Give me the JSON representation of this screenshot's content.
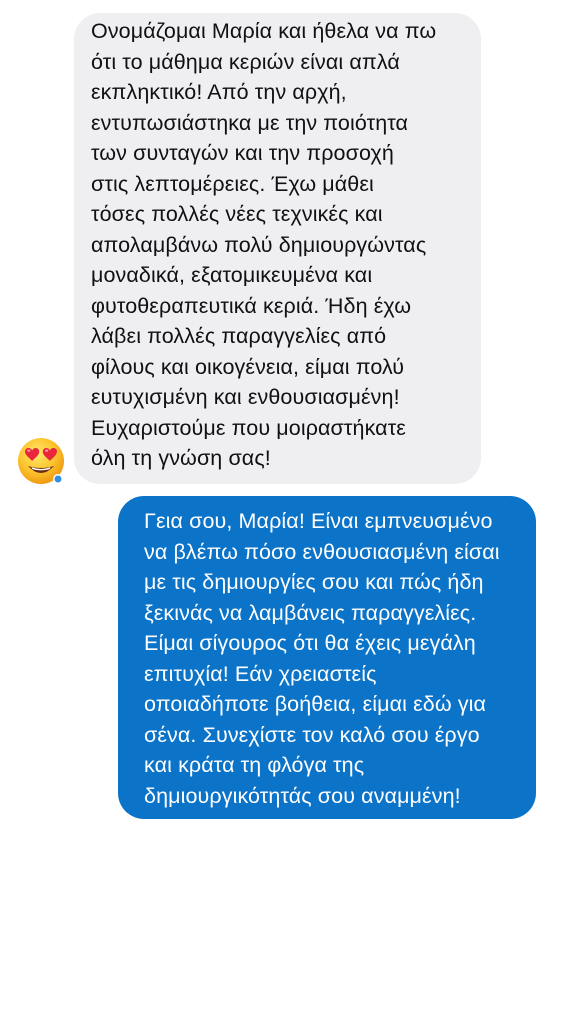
{
  "conversation": {
    "messages": [
      {
        "direction": "incoming",
        "text": "Ονομάζομαι Μαρία και ήθελα να πω\nότι το μάθημα κεριών είναι απλά\nεκπληκτικό! Από την αρχή,\nεντυπωσιάστηκα με την ποιότητα\nτων συνταγών και την προσοχή\nστις λεπτομέρειες. Έχω μάθει\nτόσες πολλές νέες τεχνικές και\nαπολαμβάνω πολύ δημιουργώντας\nμοναδικά, εξατομικευμένα και\nφυτοθεραπευτικά κεριά. Ήδη έχω\nλάβει πολλές παραγγελίες από\nφίλους και οικογένεια, είμαι πολύ\nευτυχισμένη και ενθουσιασμένη!\nΕυχαριστούμε που μοιραστήκατε\nόλη τη γνώση σας!",
        "reaction_icon": "heart-eyes-emoji",
        "bubble_color": "#efeff2"
      },
      {
        "direction": "outgoing",
        "text": "Γεια σου, Μαρία!  Είναι εμπνευσμένο\nνα βλέπω πόσο ενθουσιασμένη είσαι\nμε τις δημιουργίες σου και πώς ήδη\nξεκινάς να λαμβάνεις παραγγελίες.\nΕίμαι σίγουρος ότι θα έχεις μεγάλη\nεπιτυχία! Εάν χρειαστείς\nοποιαδήποτε βοήθεια, είμαι εδώ για\nσένα. Συνεχίστε τον καλό σου έργο\nκαι κράτα τη φλόγα της\nδημιουργικότητάς σου αναμμένη!",
        "bubble_color": "#0b73c8"
      }
    ]
  }
}
